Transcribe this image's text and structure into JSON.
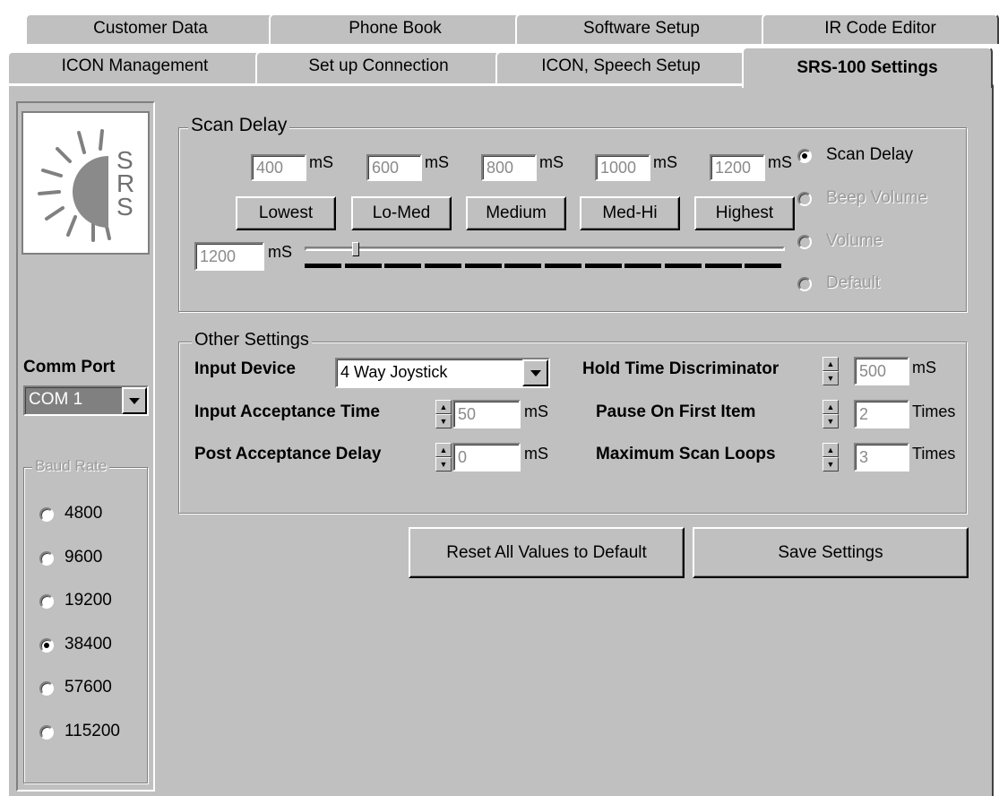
{
  "tabs_row1": [
    {
      "label": "Customer Data"
    },
    {
      "label": "Phone Book"
    },
    {
      "label": "Software Setup"
    },
    {
      "label": "IR Code Editor"
    }
  ],
  "tabs_row2": [
    {
      "label": "ICON Management"
    },
    {
      "label": "Set up  Connection"
    },
    {
      "label": "ICON, Speech Setup"
    },
    {
      "label": "SRS-100 Settings",
      "active": true
    }
  ],
  "logo": {
    "text": "SRS"
  },
  "comm_port": {
    "label": "Comm Port",
    "value": "COM 1"
  },
  "baud_rate": {
    "label": "Baud Rate",
    "options": [
      "4800",
      "9600",
      "19200",
      "38400",
      "57600",
      "115200"
    ],
    "selected": "38400"
  },
  "scan_delay": {
    "title": "Scan Delay",
    "presets": [
      {
        "value": "400",
        "unit": "mS",
        "button": "Lowest"
      },
      {
        "value": "600",
        "unit": "mS",
        "button": "Lo-Med"
      },
      {
        "value": "800",
        "unit": "mS",
        "button": "Medium"
      },
      {
        "value": "1000",
        "unit": "mS",
        "button": "Med-Hi"
      },
      {
        "value": "1200",
        "unit": "mS",
        "button": "Highest"
      }
    ],
    "current_value": "1200",
    "current_unit": "mS",
    "slider_level": 0.1,
    "mode_options": [
      {
        "label": "Scan Delay",
        "selected": true,
        "enabled": true
      },
      {
        "label": "Beep Volume",
        "selected": false,
        "enabled": false
      },
      {
        "label": "Volume",
        "selected": false,
        "enabled": false
      },
      {
        "label": "Default",
        "selected": false,
        "enabled": false
      }
    ]
  },
  "other_settings": {
    "title": "Other Settings",
    "input_device": {
      "label": "Input Device",
      "value": "4 Way Joystick"
    },
    "input_acceptance_time": {
      "label": "Input Acceptance Time",
      "value": "50",
      "unit": "mS"
    },
    "post_acceptance_delay": {
      "label": "Post Acceptance Delay",
      "value": "0",
      "unit": "mS"
    },
    "hold_time_discriminator": {
      "label": "Hold Time Discriminator",
      "value": "500",
      "unit": "mS"
    },
    "pause_on_first_item": {
      "label": "Pause On First Item",
      "value": "2",
      "unit": "Times"
    },
    "maximum_scan_loops": {
      "label": "Maximum Scan Loops",
      "value": "3",
      "unit": "Times"
    }
  },
  "actions": {
    "reset_label": "Reset All Values to Default",
    "save_label": "Save Settings"
  }
}
